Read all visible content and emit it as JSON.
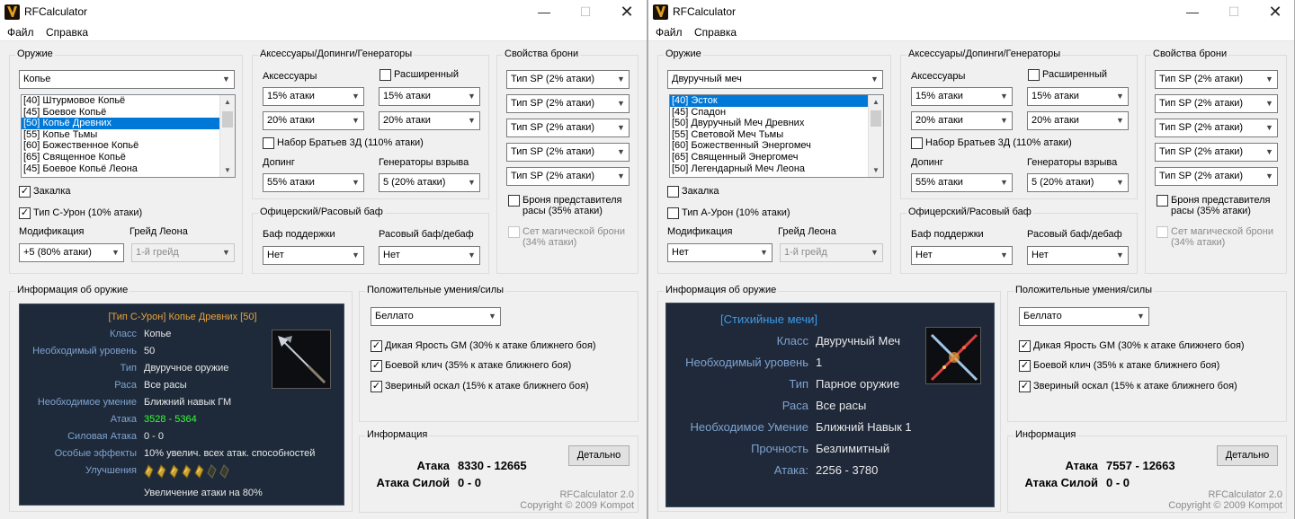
{
  "windows": [
    {
      "title": "RFCalculator",
      "menu": [
        "Файл",
        "Справка"
      ],
      "weapon_group": {
        "title": "Оружие",
        "type_value": "Копье",
        "list_items": [
          "[40] Штурмовое Копьё",
          "[45] Боевое Копьё",
          "[50] Копьё Древних",
          "[55] Копье Тьмы",
          "[60] Божественное Копьё",
          "[65] Священное Копьё",
          "[45] Боевое Копьё Леона"
        ],
        "selected_index": 2,
        "hardening_label": "Закалка",
        "hardening_checked": true,
        "type_label": "Тип С-Урон (10% атаки)",
        "type_checked": true,
        "mod_label": "Модификация",
        "mod_value": "+5 (80% атаки)",
        "grade_label": "Грейд Леона",
        "grade_value": "1-й грейд"
      },
      "acc_group": {
        "title": "Аксессуары/Допинги/Генераторы",
        "acc_label": "Аксессуары",
        "extended_label": "Расширенный",
        "extended_checked": false,
        "acc1": "15% атаки",
        "acc2": "15% атаки",
        "acc3": "20% атаки",
        "acc4": "20% атаки",
        "brothers_label": "Набор Братьев 3Д (110% атаки)",
        "brothers_checked": false,
        "doping_label": "Допинг",
        "doping_value": "55% атаки",
        "gen_label": "Генераторы взрыва",
        "gen_value": "5 (20% атаки)"
      },
      "buff_group": {
        "title": "Офицерский/Расовый баф",
        "support_label": "Баф поддержки",
        "support_value": "Нет",
        "race_label": "Расовый баф/дебаф",
        "race_value": "Нет"
      },
      "armor_group": {
        "title": "Свойства брони",
        "items": [
          "Тип SP (2% атаки)",
          "Тип SP (2% атаки)",
          "Тип SP (2% атаки)",
          "Тип SP (2% атаки)",
          "Тип SP (2% атаки)"
        ],
        "rep_label": "Броня представителя расы (35% атаки)",
        "rep_checked": false,
        "magic_label": "Сет магической брони (34% атаки)",
        "magic_checked": false
      },
      "weapon_info": {
        "title": "Информация об оружие",
        "header": "[Тип С-Урон] Копье Древних [50]",
        "rows": [
          {
            "k": "Класс",
            "v": "Копье"
          },
          {
            "k": "Необходимый уровень",
            "v": "50"
          },
          {
            "k": "Тип",
            "v": "Двуручное оружие"
          },
          {
            "k": "Раса",
            "v": "Все расы"
          },
          {
            "k": "Необходимое умение",
            "v": "Ближний навык ГМ"
          },
          {
            "k": "Атака",
            "v": "3528 - 5364"
          },
          {
            "k": "Силовая Атака",
            "v": "0 - 0"
          },
          {
            "k": "Особые эффекты",
            "v": "10% увелич. всех атак. способностей"
          },
          {
            "k": "Улучшения",
            "v": ""
          }
        ],
        "footer": "Увеличение атаки на 80%"
      },
      "skills": {
        "title": "Положительные умения/силы",
        "combo_value": "Беллато",
        "items": [
          "Дикая Ярость GM (30% к атаке ближнего боя)",
          "Боевой клич (35% к атаке ближнего боя)",
          "Звериный оскал (15% к атаке ближнего боя)"
        ]
      },
      "info": {
        "title": "Информация",
        "detail_button": "Детально",
        "attack_label": "Атака",
        "attack_value": "8330 - 12665",
        "force_label": "Атака Силой",
        "force_value": "0 - 0",
        "version": "RFCalculator 2.0",
        "copyright": "Copyright © 2009 Kompot"
      }
    },
    {
      "title": "RFCalculator",
      "menu": [
        "Файл",
        "Справка"
      ],
      "weapon_group": {
        "title": "Оружие",
        "type_value": "Двуручный меч",
        "list_items": [
          "[40] Эсток",
          "[45] Спадон",
          "[50] Двуручный Меч Древних",
          "[55] Световой Меч Тьмы",
          "[60] Божественный Энергомеч",
          "[65] Священный Энергомеч",
          "[50] Легендарный Меч Леона"
        ],
        "selected_index": 0,
        "hardening_label": "Закалка",
        "hardening_checked": false,
        "type_label": "Тип А-Урон (10% атаки)",
        "type_checked": false,
        "mod_label": "Модификация",
        "mod_value": "Нет",
        "grade_label": "Грейд Леона",
        "grade_value": "1-й грейд"
      },
      "acc_group": {
        "title": "Аксессуары/Допинги/Генераторы",
        "acc_label": "Аксессуары",
        "extended_label": "Расширенный",
        "extended_checked": false,
        "acc1": "15% атаки",
        "acc2": "15% атаки",
        "acc3": "20% атаки",
        "acc4": "20% атаки",
        "brothers_label": "Набор Братьев 3Д (110% атаки)",
        "brothers_checked": false,
        "doping_label": "Допинг",
        "doping_value": "55% атаки",
        "gen_label": "Генераторы взрыва",
        "gen_value": "5 (20% атаки)"
      },
      "buff_group": {
        "title": "Офицерский/Расовый баф",
        "support_label": "Баф поддержки",
        "support_value": "Нет",
        "race_label": "Расовый баф/дебаф",
        "race_value": "Нет"
      },
      "armor_group": {
        "title": "Свойства брони",
        "items": [
          "Тип SP (2% атаки)",
          "Тип SP (2% атаки)",
          "Тип SP (2% атаки)",
          "Тип SP (2% атаки)",
          "Тип SP (2% атаки)"
        ],
        "rep_label": "Броня представителя расы (35% атаки)",
        "rep_checked": false,
        "magic_label": "Сет магической брони (34% атаки)",
        "magic_checked": false
      },
      "weapon_info": {
        "title": "Информация об оружие",
        "header": "[Стихийные мечи]",
        "rows": [
          {
            "k": "Класс",
            "v": "Двуручный Меч"
          },
          {
            "k": "Необходимый уровень",
            "v": "1"
          },
          {
            "k": "Тип",
            "v": "Парное оружие"
          },
          {
            "k": "Раса",
            "v": "Все расы"
          },
          {
            "k": "Необходимое Умение",
            "v": "Ближний Навык 1"
          },
          {
            "k": "Прочность",
            "v": "Безлимитный"
          },
          {
            "k": "Атака:",
            "v": "2256 - 3780"
          }
        ],
        "footer": ""
      },
      "skills": {
        "title": "Положительные умения/силы",
        "combo_value": "Беллато",
        "items": [
          "Дикая Ярость GM (30% к атаке ближнего боя)",
          "Боевой клич (35% к атаке ближнего боя)",
          "Звериный оскал (15% к атаке ближнего боя)"
        ]
      },
      "info": {
        "title": "Информация",
        "detail_button": "Детально",
        "attack_label": "Атака",
        "attack_value": "7557 - 12663",
        "force_label": "Атака Силой",
        "force_value": "0 - 0",
        "version": "RFCalculator 2.0",
        "copyright": "Copyright © 2009 Kompot"
      }
    }
  ],
  "icons": [
    "app-icon",
    "minimize-icon",
    "maximize-icon",
    "close-icon",
    "dropdown-arrow-icon",
    "checkmark-icon",
    "spear-icon",
    "crossed-swords-icon",
    "upgrade-talic-icon"
  ],
  "colors": {
    "tooltip_bg": "#1e2a3a",
    "tooltip_key": "#7ea3cf",
    "tooltip_header_1": "#e8a33a",
    "tooltip_header_2": "#3b9be8",
    "attack_green": "#33ff33",
    "selection": "#0078d7"
  }
}
